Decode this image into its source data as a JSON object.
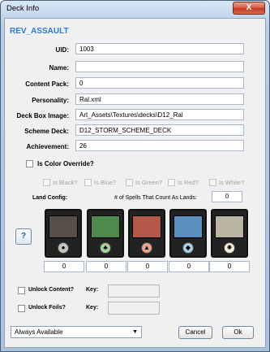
{
  "window": {
    "title": "Deck Info",
    "close_label": "X"
  },
  "deck_name": "REV_ASSAULT",
  "fields": {
    "uid": {
      "label": "UID:",
      "value": "1003"
    },
    "name": {
      "label": "Name:",
      "value": ""
    },
    "content_pack": {
      "label": "Content Pack:",
      "value": "0"
    },
    "personality": {
      "label": "Personality:",
      "value": "Ral.xml"
    },
    "deck_box_image": {
      "label": "Deck Box Image:",
      "value": "Art_Assets\\Textures\\decks\\D12_Ral"
    },
    "scheme_deck": {
      "label": "Scheme Deck:",
      "value": "D12_STORM_SCHEME_DECK"
    },
    "achievement": {
      "label": "Achievement:",
      "value": "26"
    }
  },
  "color_override": {
    "label": "Is Color Override?",
    "checked": false
  },
  "color_checks": [
    {
      "label": "Is Black?"
    },
    {
      "label": "Is Blue?"
    },
    {
      "label": "Is Green?"
    },
    {
      "label": "Is Red?"
    },
    {
      "label": "Is White?"
    }
  ],
  "land_config": {
    "label": "Land Config:",
    "spells_label": "# of Spells That Count As Lands:",
    "spells_value": "0"
  },
  "help_label": "?",
  "lands": [
    {
      "name": "Swamp",
      "icon": "swamp-icon",
      "count": "0",
      "art": "#57504a",
      "sym_bg": "#c8c2bd",
      "glyph": "●"
    },
    {
      "name": "Forest",
      "icon": "forest-icon",
      "count": "0",
      "art": "#4d8a4c",
      "sym_bg": "#a6cf9b",
      "glyph": "♣"
    },
    {
      "name": "Mountain",
      "icon": "mountain-icon",
      "count": "0",
      "art": "#b5584a",
      "sym_bg": "#eba58f",
      "glyph": "▲"
    },
    {
      "name": "Island",
      "icon": "island-icon",
      "count": "0",
      "art": "#5a90c0",
      "sym_bg": "#a9cfe9",
      "glyph": "◆"
    },
    {
      "name": "Plains",
      "icon": "plains-icon",
      "count": "0",
      "art": "#b9b4a3",
      "sym_bg": "#f4efd6",
      "glyph": "✺"
    }
  ],
  "unlock_content": {
    "label": "Unlock Content?",
    "key_label": "Key:",
    "key_value": ""
  },
  "unlock_foils": {
    "label": "Unlock Foils?",
    "key_label": "Key:",
    "key_value": ""
  },
  "availability": {
    "selected": "Always Available"
  },
  "buttons": {
    "cancel": "Cancel",
    "ok": "Ok"
  }
}
